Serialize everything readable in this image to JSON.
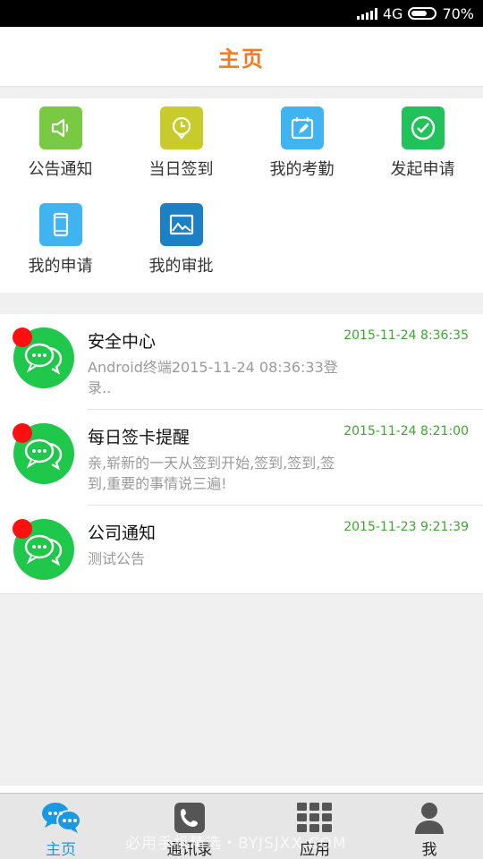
{
  "status_bar": {
    "network": "4G",
    "battery": "70%",
    "battery_level": 0.7
  },
  "header": {
    "title": "主页"
  },
  "grid": {
    "items": [
      {
        "label": "公告通知",
        "icon": "speaker-icon",
        "color": "#7ac943"
      },
      {
        "label": "当日签到",
        "icon": "clock-pin-icon",
        "color": "#c8cc2a"
      },
      {
        "label": "我的考勤",
        "icon": "calendar-edit-icon",
        "color": "#3fb4f0"
      },
      {
        "label": "发起申请",
        "icon": "check-circle-icon",
        "color": "#22c25a"
      },
      {
        "label": "我的申请",
        "icon": "phone-icon",
        "color": "#3fb4f0"
      },
      {
        "label": "我的审批",
        "icon": "image-icon",
        "color": "#1b80c4"
      }
    ]
  },
  "messages": [
    {
      "name": "安全中心",
      "time": "2015-11-24 8:36:35",
      "preview": "Android终端2015-11-24 08:36:33登录.."
    },
    {
      "name": "每日签卡提醒",
      "time": "2015-11-24 8:21:00",
      "preview": "亲,崭新的一天从签到开始,签到,签到,签到,重要的事情说三遍!"
    },
    {
      "name": "公司通知",
      "time": "2015-11-23 9:21:39",
      "preview": "测试公告"
    }
  ],
  "tabbar": {
    "tabs": [
      {
        "label": "主页",
        "icon": "chat-bubbles-icon",
        "active": true
      },
      {
        "label": "通讯录",
        "icon": "phone-handset-icon",
        "active": false
      },
      {
        "label": "应用",
        "icon": "apps-grid-icon",
        "active": false
      },
      {
        "label": "我",
        "icon": "user-icon",
        "active": false
      }
    ]
  },
  "watermark": "必用手机精选・BYJSJXX.COM",
  "colors": {
    "accent": "#f07a1d",
    "time_green": "#3aa82d",
    "active_tab": "#1a98e4",
    "badge_red": "#ff1010"
  }
}
